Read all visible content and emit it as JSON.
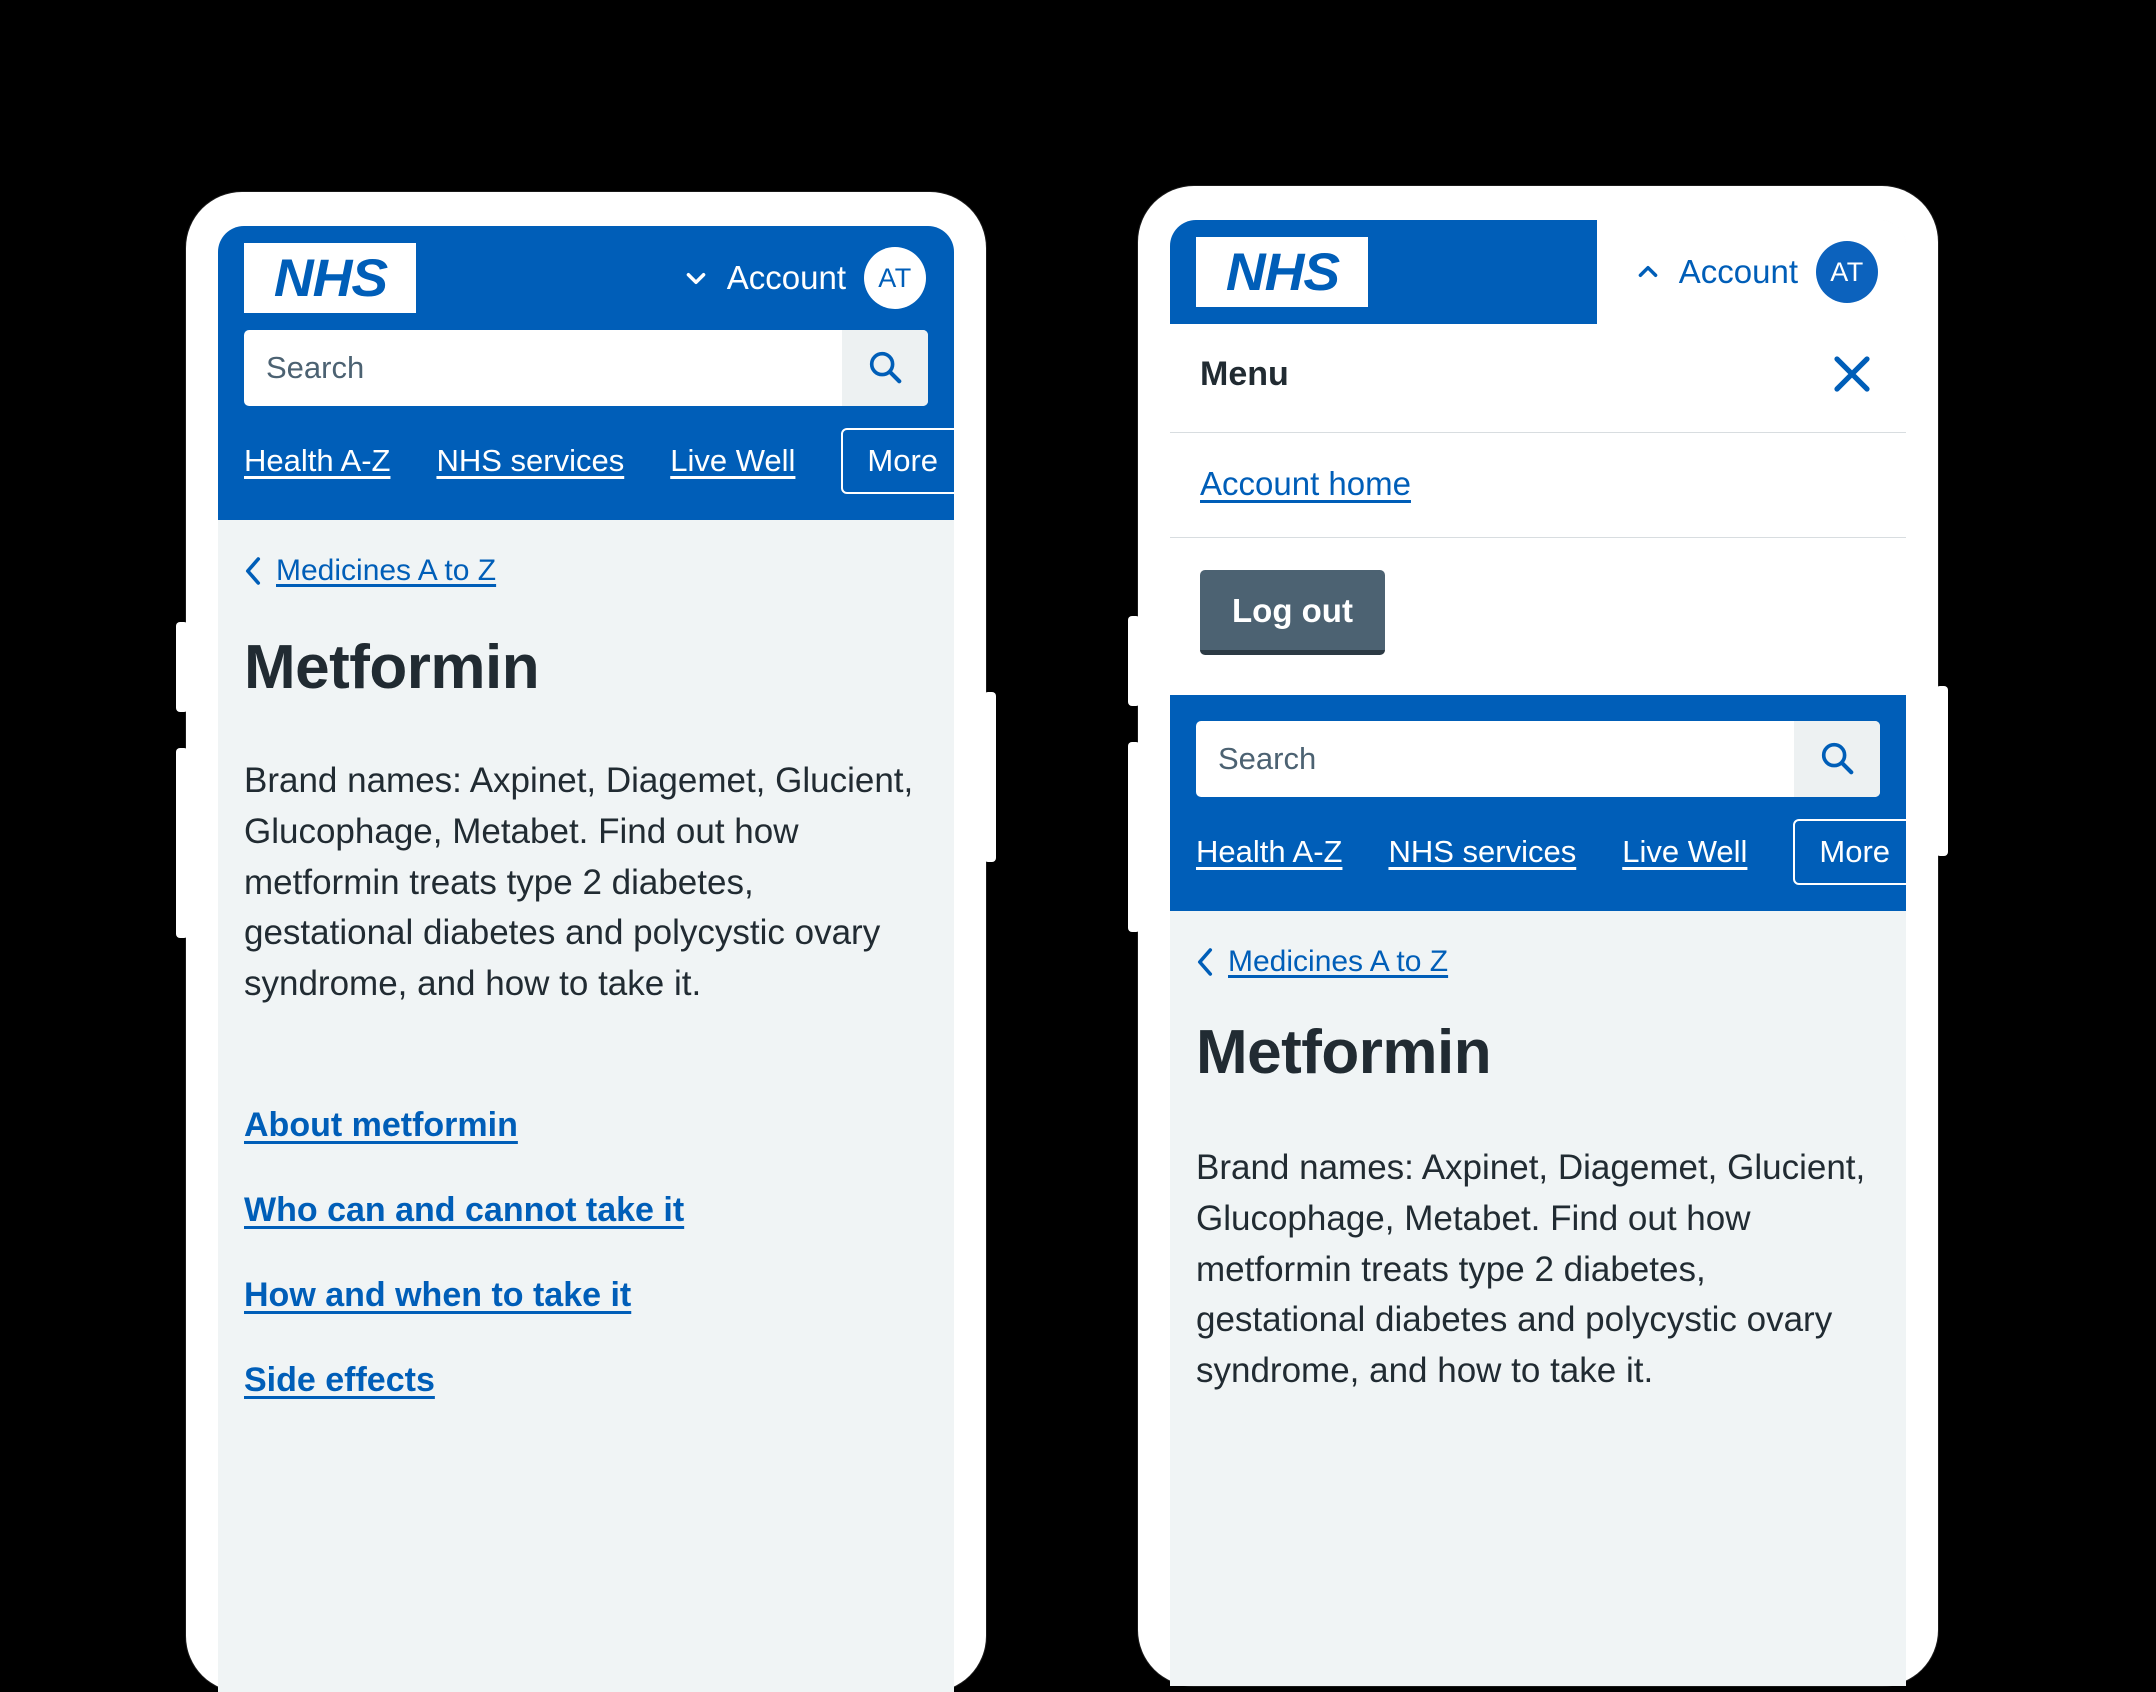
{
  "brand": {
    "logo_text": "NHS",
    "blue": "#005eb8",
    "page_bg": "#f0f4f5",
    "text_dark": "#212b32",
    "grey_button": "#4c6272"
  },
  "phone_left": {
    "header": {
      "account_label": "Account",
      "account_chevron": "chevron-down-icon",
      "avatar_initials": "AT"
    },
    "search": {
      "placeholder": "Search",
      "value": "",
      "button_icon": "search-icon"
    },
    "nav": {
      "links": [
        "Health A-Z",
        "NHS services",
        "Live Well"
      ],
      "more_label": "More"
    },
    "content": {
      "breadcrumb_label": "Medicines A to Z",
      "breadcrumb_icon": "chevron-left-icon",
      "title": "Metformin",
      "lede": "Brand names: Axpinet, Diagemet, Glucient, Glucophage, Metabet. Find out how metformin treats type 2 diabetes, gestational diabetes and polycystic ovary syndrome, and how to take it.",
      "toc": [
        "About metformin",
        "Who can and cannot take it",
        "How and when to take it",
        "Side effects"
      ]
    }
  },
  "phone_right": {
    "header": {
      "account_label": "Account",
      "account_chevron": "chevron-up-icon",
      "avatar_initials": "AT"
    },
    "menu": {
      "title": "Menu",
      "close_icon": "close-icon",
      "links": [
        "Account home"
      ],
      "logout_label": "Log out"
    },
    "search": {
      "placeholder": "Search",
      "value": "",
      "button_icon": "search-icon"
    },
    "nav": {
      "links": [
        "Health A-Z",
        "NHS services",
        "Live Well"
      ],
      "more_label": "More"
    },
    "content": {
      "breadcrumb_label": "Medicines A to Z",
      "breadcrumb_icon": "chevron-left-icon",
      "title": "Metformin",
      "lede": "Brand names: Axpinet, Diagemet, Glucient, Glucophage, Metabet. Find out how metformin treats type 2 diabetes, gestational diabetes and polycystic ovary syndrome, and how to take it."
    }
  }
}
